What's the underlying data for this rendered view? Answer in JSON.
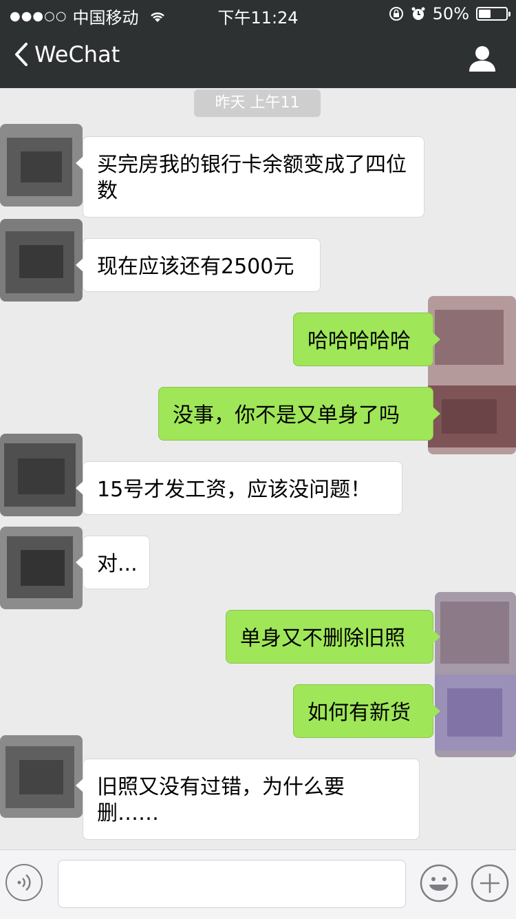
{
  "status_bar": {
    "carrier": "中国移动",
    "time": "下午11:24",
    "battery": "50%",
    "battery_level": 0.5,
    "signal_icon": "signal-dots-icon",
    "wifi_icon": "wifi-icon",
    "lock_icon": "rotation-lock-icon",
    "alarm_icon": "alarm-icon"
  },
  "nav": {
    "back_label": "WeChat",
    "back_icon": "chevron-left-icon",
    "profile_icon": "person-icon"
  },
  "chat": {
    "timestamp": "昨天 上午11",
    "messages": [
      {
        "from": "them",
        "text": "买完房我的银行卡余额变成了四位数"
      },
      {
        "from": "them",
        "text": "现在应该还有2500元"
      },
      {
        "from": "me",
        "text": "哈哈哈哈哈"
      },
      {
        "from": "me",
        "text": "没事，你不是又单身了吗"
      },
      {
        "from": "them",
        "text": "15号才发工资，应该没问题！"
      },
      {
        "from": "them",
        "text": "对..."
      },
      {
        "from": "me",
        "text": "单身又不删除旧照"
      },
      {
        "from": "me",
        "text": "如何有新货"
      },
      {
        "from": "them",
        "text": "旧照又没有过错，为什么要删……"
      }
    ]
  },
  "input_bar": {
    "placeholder": "",
    "voice_icon": "voice-icon",
    "emoji_icon": "emoji-icon",
    "plus_icon": "plus-icon"
  },
  "colors": {
    "bar": "#2e3132",
    "background": "#ebebeb",
    "outgoing_bubble": "#9fe658",
    "incoming_bubble": "#ffffff"
  }
}
